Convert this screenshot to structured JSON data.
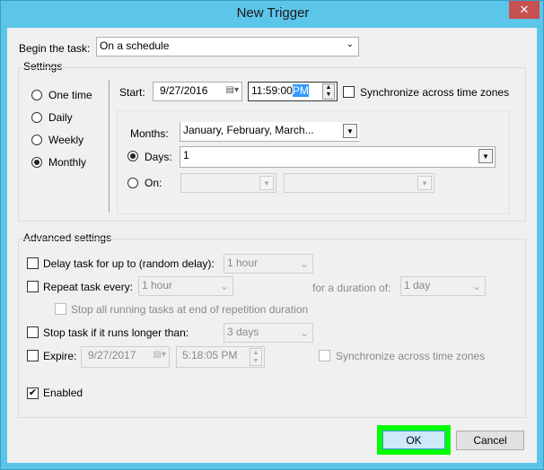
{
  "window": {
    "title": "New Trigger",
    "close_icon": "close-icon"
  },
  "begin": {
    "label": "Begin the task:",
    "value": "On a schedule"
  },
  "settings": {
    "label": "Settings",
    "schedule_options": [
      {
        "label": "One time",
        "selected": false
      },
      {
        "label": "Daily",
        "selected": false
      },
      {
        "label": "Weekly",
        "selected": false
      },
      {
        "label": "Monthly",
        "selected": true
      }
    ],
    "start_label": "Start:",
    "start_date": "9/27/2016",
    "start_time": "11:59:00",
    "start_ampm": "PM",
    "sync_label": "Synchronize across time zones",
    "sync_checked": false,
    "months_label": "Months:",
    "months_value": "January, February, March...",
    "days_label": "Days:",
    "days_value": "1",
    "days_selected": true,
    "on_label": "On:",
    "on_selected": false
  },
  "advanced": {
    "label": "Advanced settings",
    "delay_label": "Delay task for up to (random delay):",
    "delay_value": "1 hour",
    "delay_checked": false,
    "repeat_label": "Repeat task every:",
    "repeat_value": "1 hour",
    "repeat_checked": false,
    "duration_label": "for a duration of:",
    "duration_value": "1 day",
    "stop_all_label": "Stop all running tasks at end of repetition duration",
    "stop_label": "Stop task if it runs longer than:",
    "stop_value": "3 days",
    "stop_checked": false,
    "expire_label": "Expire:",
    "expire_date": "9/27/2017",
    "expire_time": "5:18:05 PM",
    "expire_checked": false,
    "expire_sync_label": "Synchronize across time zones",
    "enabled_label": "Enabled",
    "enabled_checked": true
  },
  "buttons": {
    "ok": "OK",
    "cancel": "Cancel"
  },
  "colors": {
    "highlight": "#00ff00",
    "title_bar": "#5cc5ea",
    "close": "#c75050"
  }
}
